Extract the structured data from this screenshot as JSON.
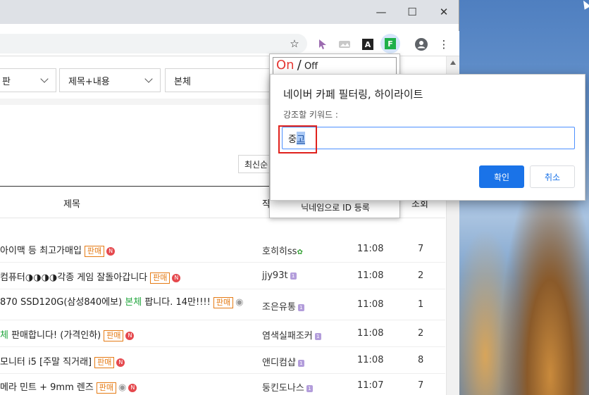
{
  "window": {
    "minimize_glyph": "—",
    "maximize_glyph": "☐",
    "close_glyph": "✕"
  },
  "toolbar": {
    "star_glyph": "☆",
    "menu_glyph": "⋮",
    "font_ext_label": "A",
    "filter_ext_label": "F"
  },
  "filters": {
    "board_select": "게시판",
    "board_visible": "판",
    "search_field_select": "제목+내용",
    "keyword_input": "본체"
  },
  "sort": {
    "label": "최신순"
  },
  "list": {
    "header_title": "제목",
    "header_author": "작",
    "header_views": "조회",
    "rows": [
      {
        "title": "아이맥 등 최고가매입",
        "tag": "판매",
        "author": "호히히ss",
        "date": "11:08",
        "views": "7"
      },
      {
        "title": "컴퓨터◑◑◑◑각종 게임 잘돌아갑니다",
        "tag": "판매",
        "author": "jjy93t",
        "date": "11:08",
        "views": "2"
      },
      {
        "title_pre": "870 SSD120G(삼성840에보) ",
        "title_hl": "본체",
        "title_post": " 팝니다. 14만!!!!",
        "tag": "판매",
        "author": "조은유통",
        "date": "11:08",
        "views": "1"
      },
      {
        "title_hl": "체",
        "title_post": " 판매합니다! (가격인하)",
        "tag": "판매",
        "author": "염색실패조커",
        "date": "11:08",
        "views": "2"
      },
      {
        "title": "모니터 i5 [주말 직거래]",
        "tag": "판매",
        "author": "앤디컴샵",
        "date": "11:08",
        "views": "8"
      },
      {
        "title": "메라 민트 + 9mm 렌즈",
        "tag": "판매",
        "author": "둥킨도나스",
        "date": "11:07",
        "views": "7"
      }
    ]
  },
  "extension_popup": {
    "on": "On",
    "slash": "/",
    "off": "Off",
    "register": "닉네임으로 ID 등록"
  },
  "dialog": {
    "title": "네이버 카페 필터링, 하이라이트",
    "prompt": "강조할 키워드 :",
    "input_value_first": "중",
    "input_value_selected": "고",
    "ok": "확인",
    "cancel": "취소"
  },
  "colors": {
    "accent": "#1a73e8",
    "tag": "#e57b15",
    "highlight_green": "#1fa53b",
    "on_red": "#e53935",
    "callout_red": "#e0211c"
  }
}
